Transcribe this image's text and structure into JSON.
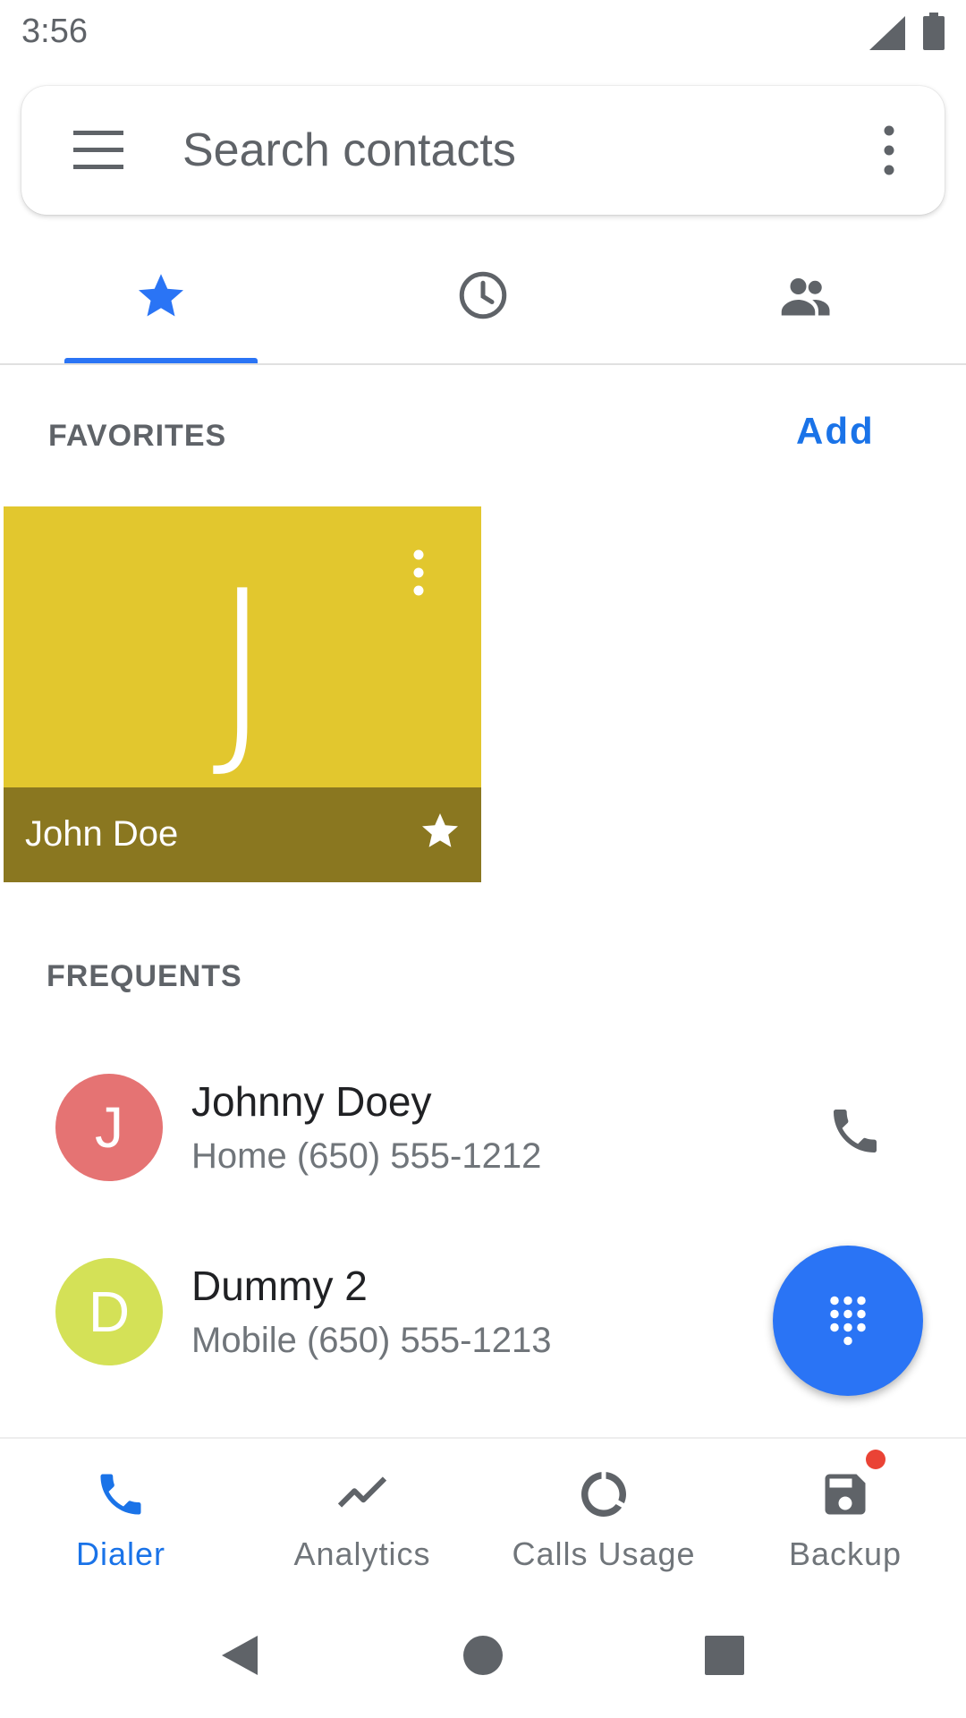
{
  "status_bar": {
    "time": "3:56",
    "icons": [
      "signal-icon",
      "battery-icon"
    ]
  },
  "search": {
    "placeholder": "Search contacts",
    "menu_icon": "menu-icon",
    "more_icon": "more-vert-icon"
  },
  "tabs": [
    {
      "icon": "star-icon",
      "selected": true
    },
    {
      "icon": "clock-icon",
      "selected": false
    },
    {
      "icon": "contacts-icon",
      "selected": false
    }
  ],
  "favorites": {
    "section_label": "FAVORITES",
    "add_label": "Add",
    "items": [
      {
        "name": "John Doe",
        "initial": "J",
        "color": "#e2c72e",
        "bar_color": "#8a7720",
        "starred": true
      }
    ]
  },
  "frequents": {
    "section_label": "FREQUENTS",
    "items": [
      {
        "name": "Johnny Doey",
        "detail": "Home (650) 555-1212",
        "initial": "J",
        "color": "#e57373",
        "call_icon": "phone-icon"
      },
      {
        "name": "Dummy 2",
        "detail": "Mobile (650) 555-1213",
        "initial": "D",
        "color": "#d4e157"
      }
    ]
  },
  "fab": {
    "icon": "dialpad-icon"
  },
  "bottom_nav": [
    {
      "label": "Dialer",
      "icon": "phone-icon",
      "active": true
    },
    {
      "label": "Analytics",
      "icon": "trending-icon",
      "active": false
    },
    {
      "label": "Calls Usage",
      "icon": "donut-icon",
      "active": false
    },
    {
      "label": "Backup",
      "icon": "save-icon",
      "active": false,
      "badge": true
    }
  ],
  "colors": {
    "accent": "#2a74f5",
    "accent_text": "#1a73e8",
    "badge": "#ea4335"
  }
}
